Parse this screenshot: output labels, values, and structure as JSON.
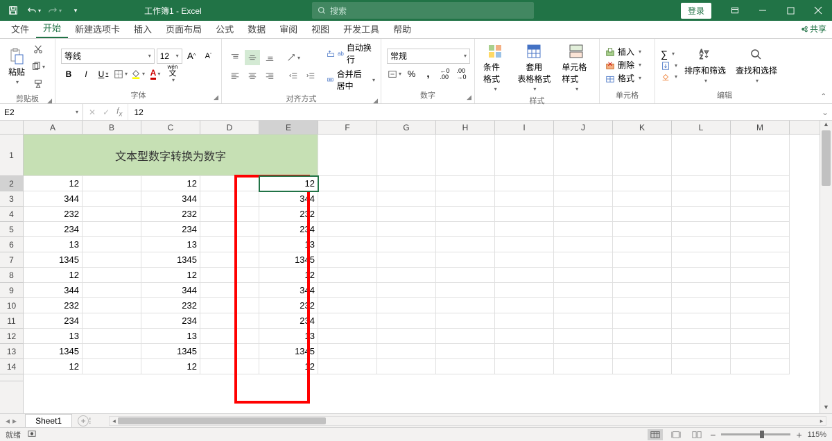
{
  "title": "工作簿1 - Excel",
  "search_placeholder": "搜索",
  "login": "登录",
  "tabs": [
    "文件",
    "开始",
    "新建选项卡",
    "插入",
    "页面布局",
    "公式",
    "数据",
    "审阅",
    "视图",
    "开发工具",
    "帮助"
  ],
  "active_tab": "开始",
  "share": "共享",
  "ribbon": {
    "clipboard": {
      "paste": "粘贴",
      "label": "剪贴板"
    },
    "font": {
      "name": "等线",
      "size": "12",
      "label": "字体",
      "bold": "B",
      "italic": "I",
      "underline": "U",
      "wen": "wén",
      "wen2": "文"
    },
    "align": {
      "wrap": "自动换行",
      "merge": "合并后居中",
      "label": "对齐方式"
    },
    "number": {
      "format": "常规",
      "label": "数字"
    },
    "styles": {
      "cond": "条件格式",
      "table": "套用\n表格格式",
      "cell": "单元格样式",
      "label": "样式"
    },
    "cells": {
      "insert": "插入",
      "delete": "删除",
      "format": "格式",
      "label": "单元格"
    },
    "editing": {
      "sort": "排序和筛选",
      "find": "查找和选择",
      "label": "编辑"
    }
  },
  "namebox": "E2",
  "formula": "12",
  "columns": [
    "A",
    "B",
    "C",
    "D",
    "E",
    "F",
    "G",
    "H",
    "I",
    "J",
    "K",
    "L",
    "M"
  ],
  "merged_title": "文本型数字转换为数字",
  "rows": [
    {
      "n": 2,
      "a": "12",
      "c": "12",
      "e": "12"
    },
    {
      "n": 3,
      "a": "344",
      "c": "344",
      "e": "344"
    },
    {
      "n": 4,
      "a": "232",
      "c": "232",
      "e": "232"
    },
    {
      "n": 5,
      "a": "234",
      "c": "234",
      "e": "234"
    },
    {
      "n": 6,
      "a": "13",
      "c": "13",
      "e": "13"
    },
    {
      "n": 7,
      "a": "1345",
      "c": "1345",
      "e": "1345"
    },
    {
      "n": 8,
      "a": "12",
      "c": "12",
      "e": "12"
    },
    {
      "n": 9,
      "a": "344",
      "c": "344",
      "e": "344"
    },
    {
      "n": 10,
      "a": "232",
      "c": "232",
      "e": "232"
    },
    {
      "n": 11,
      "a": "234",
      "c": "234",
      "e": "234"
    },
    {
      "n": 12,
      "a": "13",
      "c": "13",
      "e": "13"
    },
    {
      "n": 13,
      "a": "1345",
      "c": "1345",
      "e": "1345"
    },
    {
      "n": 14,
      "a": "12",
      "c": "12",
      "e": "12"
    }
  ],
  "sheet": "Sheet1",
  "status": "就绪",
  "zoom": "115%"
}
